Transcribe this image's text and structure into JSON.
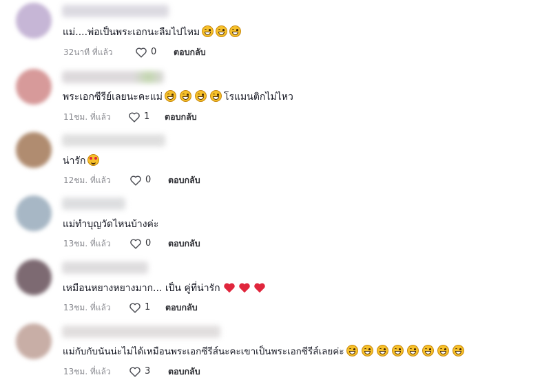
{
  "comments": [
    {
      "text": "แม่....พ่อเป็นพระเอกนะลืมไปไหม",
      "emojis": [
        "grinning-squinting-face",
        "grinning-squinting-face",
        "grinning-squinting-face"
      ],
      "timestamp": "32นาที ที่แล้ว",
      "likes": "0",
      "reply_label": "ตอบกลับ"
    },
    {
      "text": "พระเอกซีรีย์เลยนะคะแม่",
      "emojis": [
        "grinning-squinting-face",
        "grinning-squinting-face",
        "grinning-squinting-face",
        "grinning-squinting-face"
      ],
      "text_after": "โรแมนติกไม่ไหว",
      "timestamp": "11ชม. ที่แล้ว",
      "likes": "1",
      "reply_label": "ตอบกลับ"
    },
    {
      "text": "น่ารัก",
      "emojis": [
        "smiling-face-with-heart-eyes"
      ],
      "timestamp": "12ชม. ที่แล้ว",
      "likes": "0",
      "reply_label": "ตอบกลับ"
    },
    {
      "text": "แม่ทำบุญวัดไหนบ้างค่ะ",
      "emojis": [],
      "timestamp": "13ชม. ที่แล้ว",
      "likes": "0",
      "reply_label": "ตอบกลับ"
    },
    {
      "text": "เหมือนหยางหยางมาก... เป็น คู่ที่น่ารัก",
      "emojis": [
        "red-heart",
        "red-heart",
        "red-heart"
      ],
      "timestamp": "13ชม. ที่แล้ว",
      "likes": "1",
      "reply_label": "ตอบกลับ"
    },
    {
      "text": "แม่กับกับนันน่ะไม่ได้เหมือนพระเอกซีรีส์นะคะเขาเป็นพระเอกซีรีส์เลยค่ะ",
      "emojis": [
        "grinning-squinting-face",
        "grinning-squinting-face",
        "grinning-squinting-face",
        "grinning-squinting-face",
        "grinning-squinting-face",
        "grinning-squinting-face",
        "grinning-squinting-face",
        "grinning-squinting-face"
      ],
      "timestamp": "13ชม. ที่แล้ว",
      "likes": "3",
      "reply_label": "ตอบกลับ"
    }
  ],
  "icons": {
    "like": "heart-outline-icon"
  },
  "colors": {
    "text": "#161823",
    "timestamp": "#8a8b91",
    "heart_emoji": "#e0263c"
  }
}
